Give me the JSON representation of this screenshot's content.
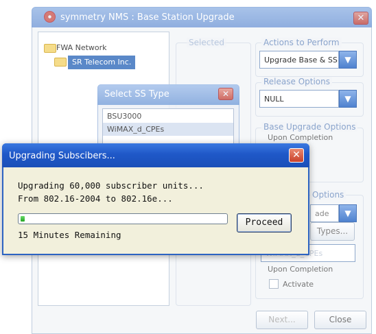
{
  "main_window": {
    "title": "symmetry NMS : Base Station Upgrade",
    "tree": {
      "root": "FWA Network",
      "child": "SR Telecom Inc."
    },
    "selected_group": {
      "label": "Selected"
    },
    "actions_group": {
      "label": "Actions to Perform",
      "value": "Upgrade Base & SS"
    },
    "release_group": {
      "label": "Release Options",
      "value": "NULL"
    },
    "base_upgrade_group": {
      "label": "Base Upgrade Options",
      "upon_completion": "Upon Completion"
    },
    "ss_options_group": {
      "label_visible": "Options",
      "combo_partial": "ade",
      "types_button_partial": "Types...",
      "field_partial": "WiMAX_d_CPEs",
      "upon_completion": "Upon Completion",
      "activate_label": "Activate"
    },
    "buttons": {
      "next": "Next...",
      "close": "Close"
    }
  },
  "select_ss_dialog": {
    "title": "Select SS Type",
    "items": [
      "BSU3000",
      "WiMAX_d_CPEs"
    ],
    "selected_index": 1
  },
  "upgrade_dialog": {
    "title": "Upgrading Subscibers...",
    "line1": "Upgrading 60,000 subscriber units...",
    "line2": "From 802.16-2004 to 802.16e...",
    "progress_fraction": 0.02,
    "progress_color": "#21a521",
    "remaining": "15 Minutes Remaining",
    "proceed_label": "Proceed"
  },
  "colors": {
    "title_bar_blue": "#1f58c8",
    "dialog_body": "#f2f0dc",
    "close_red": "#c9402a"
  }
}
